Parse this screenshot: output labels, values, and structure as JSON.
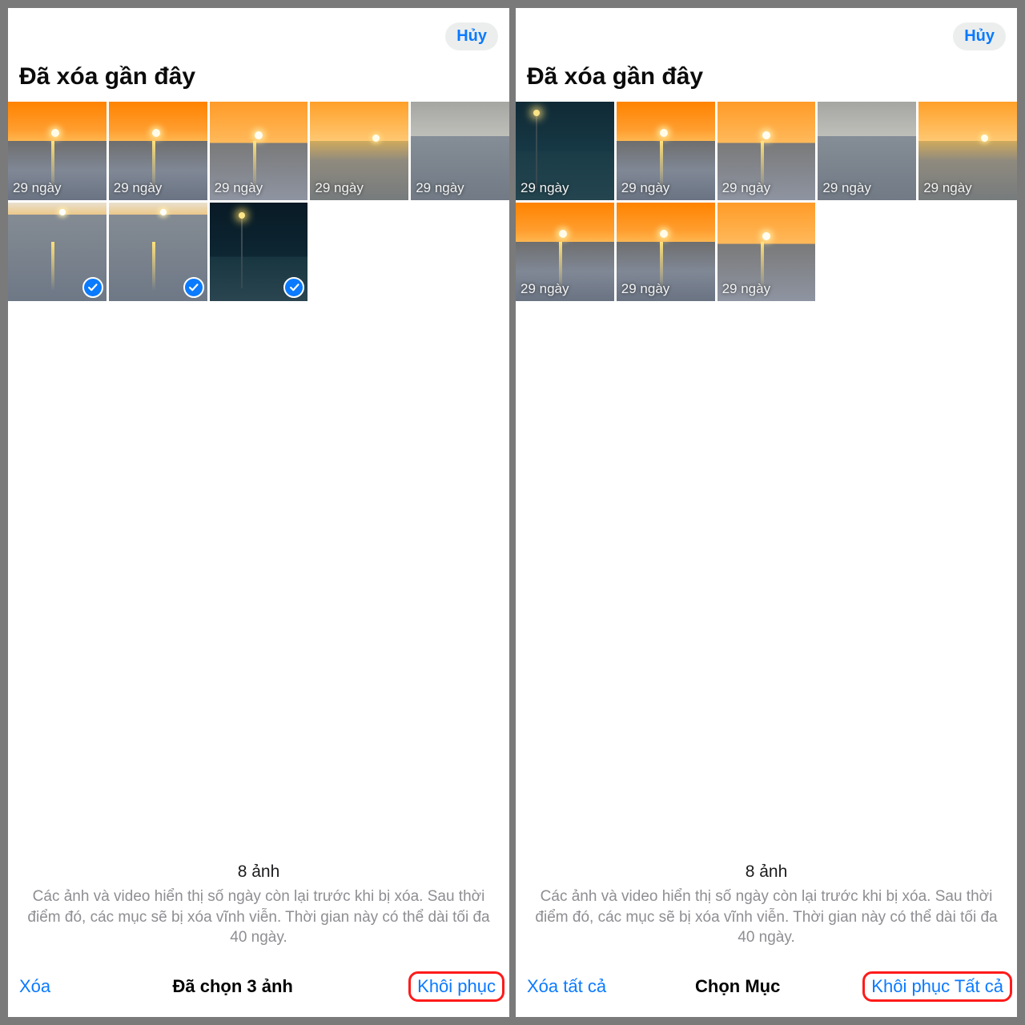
{
  "panes": {
    "left": {
      "header": {
        "cancel": "Hủy",
        "title": "Đã xóa gần đây"
      },
      "thumbs": [
        {
          "img": "img-sunset1 has-reflect",
          "label": "29 ngày",
          "selected": false
        },
        {
          "img": "img-sunset1 has-reflect",
          "label": "29 ngày",
          "selected": false
        },
        {
          "img": "img-sunset2 has-reflect",
          "label": "29 ngày",
          "selected": false
        },
        {
          "img": "img-sunset3",
          "label": "29 ngày",
          "selected": false
        },
        {
          "img": "img-sea",
          "label": "29 ngày",
          "selected": false
        },
        {
          "img": "img-seasun has-reflect",
          "label": "",
          "selected": true
        },
        {
          "img": "img-seasun has-reflect",
          "label": "",
          "selected": true
        },
        {
          "img": "img-night img-night-lamp",
          "label": "",
          "selected": true
        }
      ],
      "summary": {
        "count": "8 ảnh",
        "desc": "Các ảnh và video hiển thị số ngày còn lại trước khi bị xóa. Sau thời điểm đó, các mục sẽ bị xóa vĩnh viễn. Thời gian này có thể dài tối đa 40 ngày."
      },
      "toolbar": {
        "left": "Xóa",
        "center": "Đã chọn 3 ảnh",
        "right": "Khôi phục"
      }
    },
    "right": {
      "header": {
        "cancel": "Hủy",
        "title": "Đã xóa gần đây"
      },
      "thumbs": [
        {
          "img": "img-night2 img-night2-lamp",
          "label": "29 ngày",
          "selected": false
        },
        {
          "img": "img-sunset1 has-reflect",
          "label": "29 ngày",
          "selected": false
        },
        {
          "img": "img-sunset2 has-reflect",
          "label": "29 ngày",
          "selected": false
        },
        {
          "img": "img-sea",
          "label": "29 ngày",
          "selected": false
        },
        {
          "img": "img-sunset3",
          "label": "29 ngày",
          "selected": false
        },
        {
          "img": "img-sunset1 has-reflect",
          "label": "29 ngày",
          "selected": false
        },
        {
          "img": "img-sunset1 has-reflect",
          "label": "29 ngày",
          "selected": false
        },
        {
          "img": "img-sunset2 has-reflect",
          "label": "29 ngày",
          "selected": false
        }
      ],
      "summary": {
        "count": "8 ảnh",
        "desc": "Các ảnh và video hiển thị số ngày còn lại trước khi bị xóa. Sau thời điểm đó, các mục sẽ bị xóa vĩnh viễn. Thời gian này có thể dài tối đa 40 ngày."
      },
      "toolbar": {
        "left": "Xóa tất cả",
        "center": "Chọn Mục",
        "right": "Khôi phục Tất cả"
      }
    }
  }
}
